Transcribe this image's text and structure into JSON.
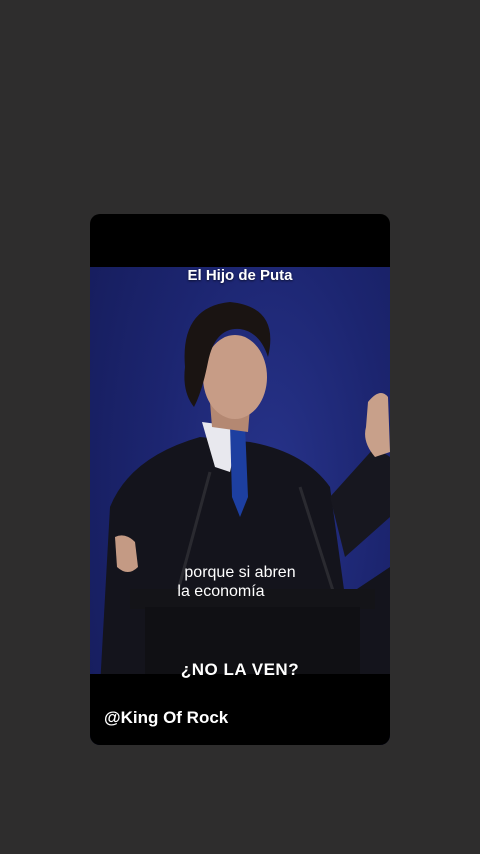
{
  "story": {
    "top_caption": "El Hijo de Puta",
    "subtitle_line1": "porque si abren",
    "subtitle_line2": "la economía",
    "headline": "¿NO LA VEN?",
    "handle": "@King Of Rock"
  },
  "colors": {
    "page_background": "#2e2d2d",
    "card_background": "#000000",
    "stage_background": "#1c2570",
    "text": "#ffffff"
  }
}
